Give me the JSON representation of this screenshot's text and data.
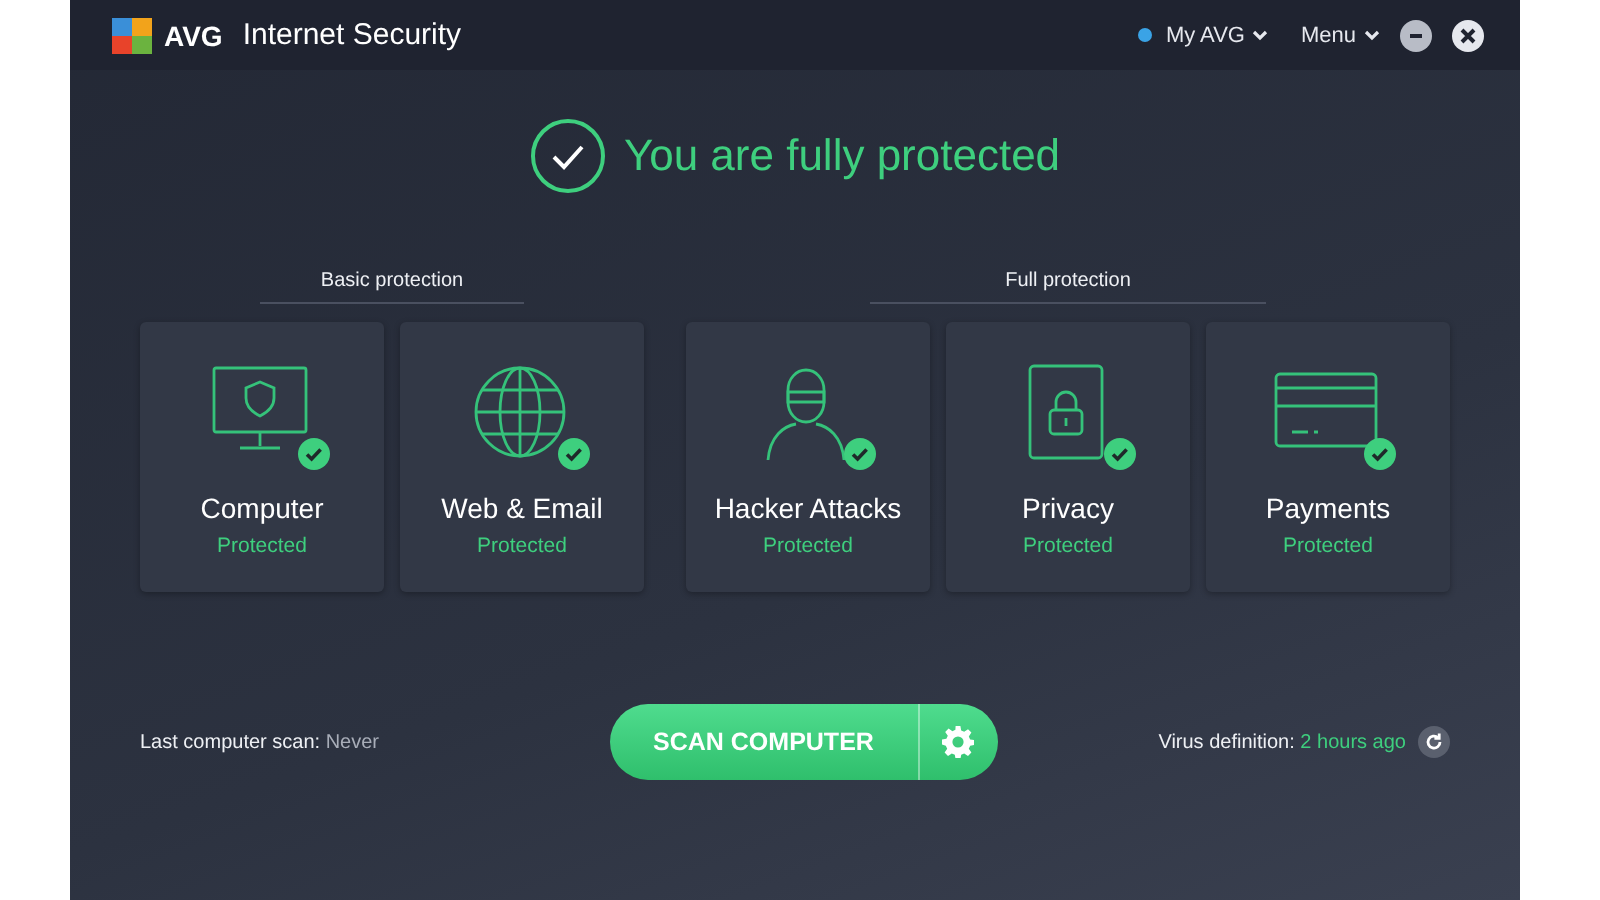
{
  "window": {
    "brand": "AVG",
    "title": "Internet Security"
  },
  "header_links": [
    {
      "label": "My AVG",
      "dot": true
    },
    {
      "label": "Menu",
      "dot": false
    }
  ],
  "headline": "You are fully protected",
  "groups": [
    {
      "label": "Basic protection",
      "cards": [
        {
          "kind": "computer",
          "title": "Computer",
          "status": "Protected",
          "ok": true
        },
        {
          "kind": "globe",
          "title": "Web & Email",
          "status": "Protected",
          "ok": true
        }
      ]
    },
    {
      "label": "Full protection",
      "cards": [
        {
          "kind": "hacker",
          "title": "Hacker Attacks",
          "status": "Protected",
          "ok": true
        },
        {
          "kind": "lock",
          "title": "Privacy",
          "status": "Protected",
          "ok": true
        },
        {
          "kind": "card",
          "title": "Payments",
          "status": "Protected",
          "ok": true
        }
      ]
    }
  ],
  "last_scan": {
    "label": "Last computer scan:",
    "value": "Never"
  },
  "scan_button": "SCAN COMPUTER",
  "virus_definition": {
    "label": "Virus definition:",
    "value": "2 hours ago"
  }
}
